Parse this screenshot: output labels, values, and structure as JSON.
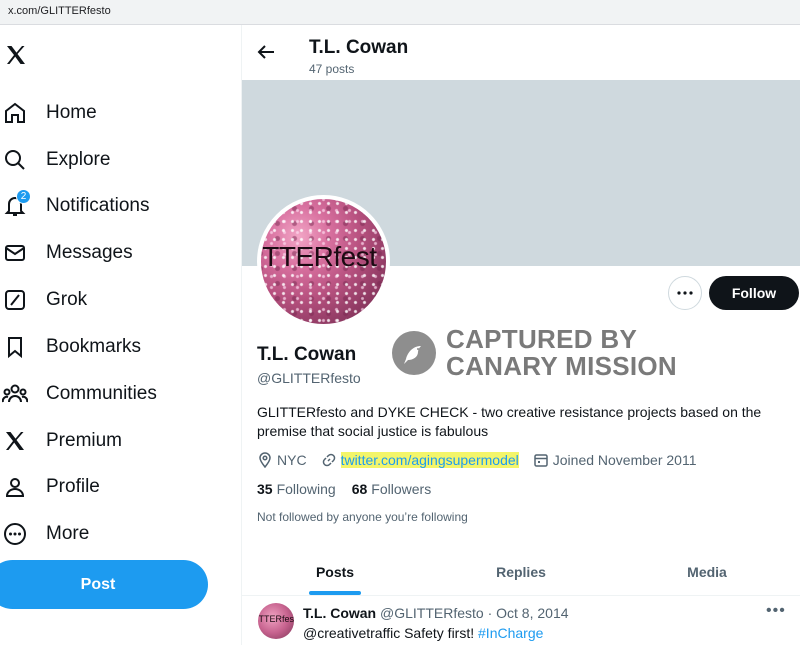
{
  "browser": {
    "url": "x.com/GLITTERfesto"
  },
  "sidebar": {
    "items": [
      {
        "label": "Home",
        "icon": "home-icon"
      },
      {
        "label": "Explore",
        "icon": "search-icon"
      },
      {
        "label": "Notifications",
        "icon": "bell-icon",
        "badge": "2"
      },
      {
        "label": "Messages",
        "icon": "envelope-icon"
      },
      {
        "label": "Grok",
        "icon": "grok-icon"
      },
      {
        "label": "Bookmarks",
        "icon": "bookmark-icon"
      },
      {
        "label": "Communities",
        "icon": "people-icon"
      },
      {
        "label": "Premium",
        "icon": "x-icon"
      },
      {
        "label": "Profile",
        "icon": "person-icon"
      },
      {
        "label": "More",
        "icon": "more-circle-icon"
      }
    ],
    "post_label": "Post"
  },
  "header": {
    "name": "T.L. Cowan",
    "post_count": "47 posts"
  },
  "profile": {
    "avatar_text": "ITTERfest",
    "name": "T.L. Cowan",
    "handle": "@GLITTERfesto",
    "bio": "GLITTERfesto and DYKE CHECK - two creative resistance projects based on the premise that social justice is fabulous",
    "location": "NYC",
    "website": "twitter.com/agingsupermodel",
    "joined": "Joined November 2011",
    "following_count": "35",
    "following_label": "Following",
    "followers_count": "68",
    "followers_label": "Followers",
    "not_followed": "Not followed by anyone you’re following",
    "follow_label": "Follow"
  },
  "watermark": {
    "line1": "CAPTURED BY",
    "line2": "CANARY MISSION"
  },
  "tabs": [
    "Posts",
    "Replies",
    "Media"
  ],
  "active_tab": "Posts",
  "tweet": {
    "avatar_text": "ITTERfest",
    "name": "T.L. Cowan",
    "handle_date": "@GLITTERfesto · Oct 8, 2014",
    "text": "@creativetraffic Safety first! ",
    "hashtag": "#InCharge"
  },
  "colors": {
    "accent": "#1d9bf0",
    "banner": "#cfd9de",
    "highlight": "#f3f56a"
  }
}
